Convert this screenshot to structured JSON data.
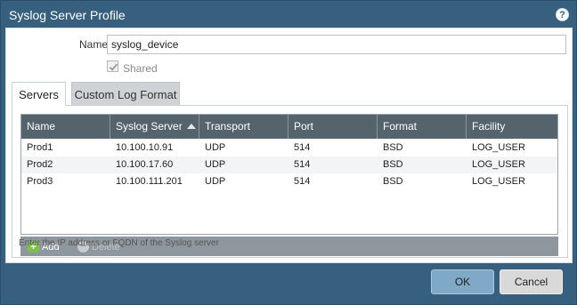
{
  "dialog": {
    "title": "Syslog Server Profile",
    "help_icon": "question-circle-icon",
    "help_text": "?"
  },
  "form": {
    "name_label": "Name",
    "name_value": "syslog_device",
    "shared_label": "Shared",
    "shared_checked": true
  },
  "tabs": [
    {
      "label": "Servers",
      "active": true
    },
    {
      "label": "Custom Log Format",
      "active": false
    }
  ],
  "table": {
    "columns": [
      "Name",
      "Syslog Server",
      "Transport",
      "Port",
      "Format",
      "Facility"
    ],
    "sorted_column": "Syslog Server",
    "rows": [
      [
        "Prod1",
        "10.100.10.91",
        "UDP",
        "514",
        "BSD",
        "LOG_USER"
      ],
      [
        "Prod2",
        "10.100.17.60",
        "UDP",
        "514",
        "BSD",
        "LOG_USER"
      ],
      [
        "Prod3",
        "10.100.111.201",
        "UDP",
        "514",
        "BSD",
        "LOG_USER"
      ]
    ]
  },
  "toolbar": {
    "add_label": "Add",
    "delete_label": "Delete",
    "add_icon": "plus-icon",
    "delete_icon": "minus-icon"
  },
  "hint": "Enter the IP address or FQDN of the Syslog server",
  "buttons": {
    "ok": "OK",
    "cancel": "Cancel"
  },
  "colors": {
    "dialog_frame": "#36607e",
    "grid_header": "#55636c",
    "ok_button": "#7fa9c7",
    "add_icon": "#7cc243"
  }
}
